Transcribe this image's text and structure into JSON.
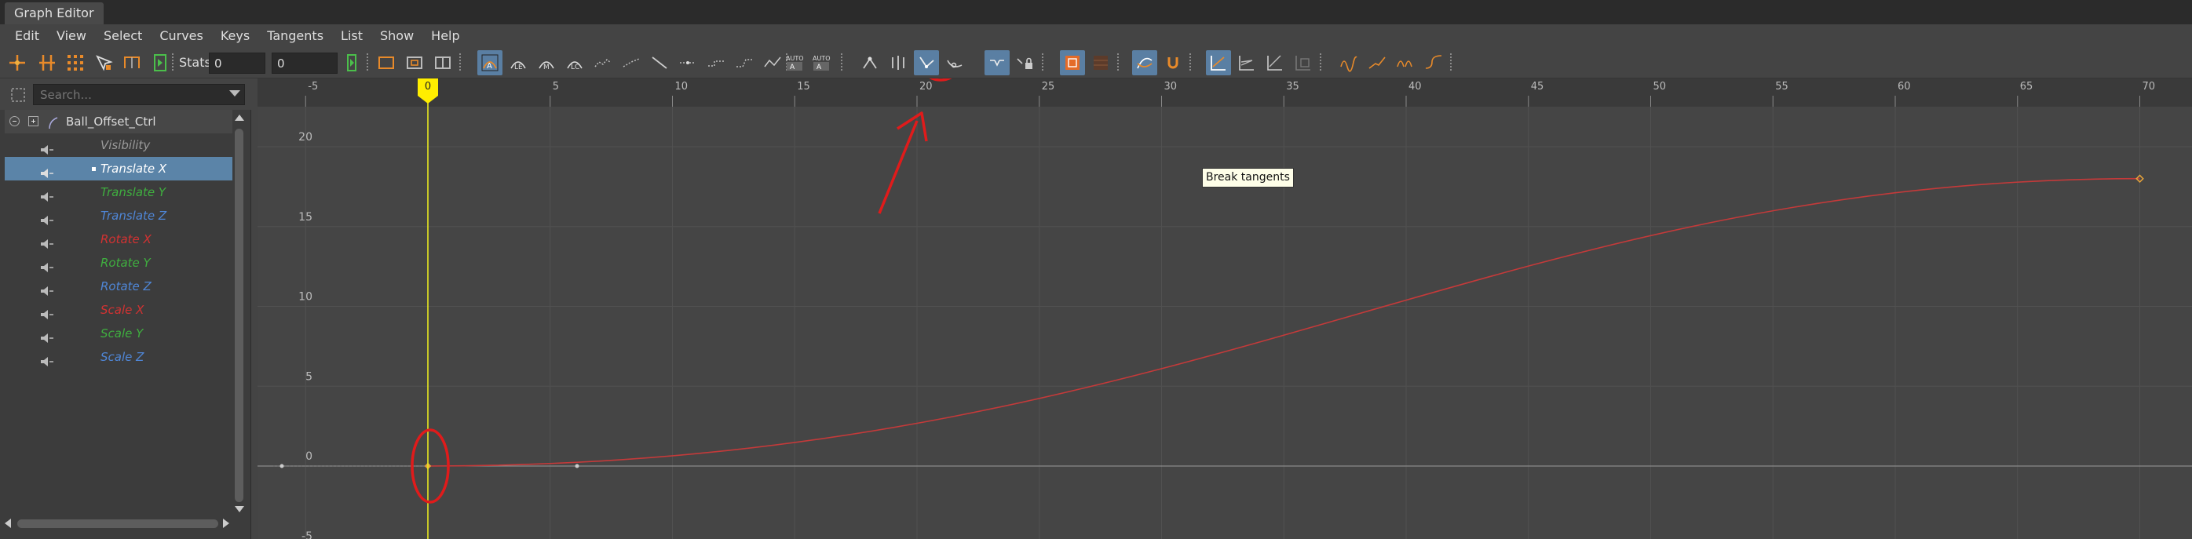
{
  "window": {
    "title": "Graph Editor"
  },
  "menu": [
    "Edit",
    "View",
    "Select",
    "Curves",
    "Keys",
    "Tangents",
    "List",
    "Show",
    "Help"
  ],
  "toolbar": {
    "stats_label": "Stats",
    "stats_value_1": "0",
    "stats_value_2": "0",
    "tooltip": "Break tangents"
  },
  "outliner": {
    "search_placeholder": "Search...",
    "root": "Ball_Offset_Ctrl",
    "channels": [
      {
        "label": "Visibility",
        "color": "#9a9a9a",
        "selected": false
      },
      {
        "label": "Translate X",
        "color": "#ffffff",
        "selected": true
      },
      {
        "label": "Translate Y",
        "color": "#3fae3f",
        "selected": false
      },
      {
        "label": "Translate Z",
        "color": "#4f86d6",
        "selected": false
      },
      {
        "label": "Rotate X",
        "color": "#d23232",
        "selected": false
      },
      {
        "label": "Rotate Y",
        "color": "#3fae3f",
        "selected": false
      },
      {
        "label": "Rotate Z",
        "color": "#4f86d6",
        "selected": false
      },
      {
        "label": "Scale X",
        "color": "#d23232",
        "selected": false
      },
      {
        "label": "Scale Y",
        "color": "#3fae3f",
        "selected": false
      },
      {
        "label": "Scale Z",
        "color": "#4f86d6",
        "selected": false
      }
    ]
  },
  "graph": {
    "current_frame": "0",
    "x_ticks": [
      "-5",
      "0",
      "5",
      "10",
      "15",
      "20",
      "25",
      "30",
      "35",
      "40",
      "45",
      "50",
      "55",
      "60",
      "65",
      "70"
    ],
    "y_ticks": [
      "20",
      "15",
      "10",
      "5",
      "0",
      "-5"
    ],
    "keys": [
      {
        "frame": 0,
        "value": 0
      },
      {
        "frame": 70,
        "value": 18
      }
    ],
    "curve_color": "#c43a3a",
    "key_color": "#e8a33a",
    "annotation_color": "#e01b1b"
  }
}
